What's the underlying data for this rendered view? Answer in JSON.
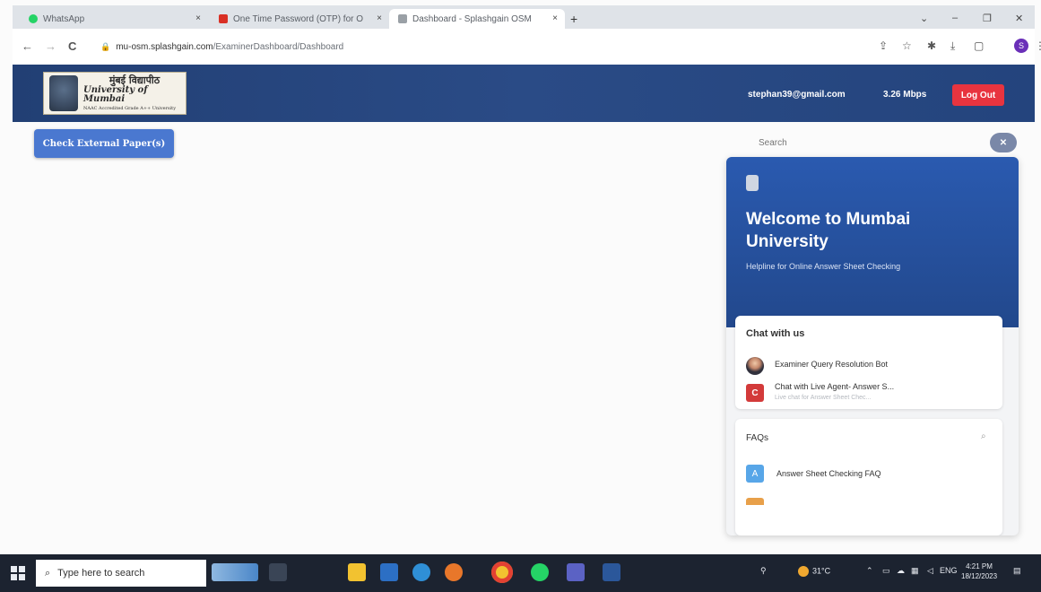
{
  "browser": {
    "tabs": [
      {
        "label": "WhatsApp",
        "favicon_color": "#25d366",
        "active": false
      },
      {
        "label": "One Time Password (OTP) for O",
        "favicon_color": "#d93025",
        "active": false
      },
      {
        "label": "Dashboard - Splashgain OSM",
        "favicon_color": "#9aa0a6",
        "active": true
      }
    ],
    "tab_close_glyph": "×",
    "new_tab_glyph": "+",
    "window_controls": [
      "⌄",
      "–",
      "❐",
      "✕"
    ],
    "nav": {
      "back": "←",
      "forward": "→",
      "reload": "C"
    },
    "url": {
      "host": "mu-osm.splashgain.com",
      "path": "/ExaminerDashboard/Dashboard"
    },
    "toolbar_icons": [
      "share-icon",
      "star-icon",
      "extensions-icon",
      "download-icon",
      "sidebar-icon"
    ],
    "profile_initial": "S",
    "menu_glyph": "⋮"
  },
  "header": {
    "logo": {
      "line1": "मुंबई विद्यापीठ",
      "line2": "University of Mumbai",
      "line3": "NAAC Accredited Grade A++ University"
    },
    "user_email": "stephan39@gmail.com",
    "speed": "3.26 Mbps",
    "logout_label": "Log Out",
    "colors": {
      "bar": "#223f74",
      "logout": "#e8343f"
    }
  },
  "main": {
    "check_button_label": "Check External Paper(s)"
  },
  "chat": {
    "search_placeholder": "Search",
    "close_glyph": "✕",
    "welcome_title": "Welcome to Mumbai University",
    "welcome_subtitle": "Helpline for Online Answer Sheet Checking",
    "chat_section_title": "Chat with us",
    "items": [
      {
        "name": "Examiner Query Resolution Bot",
        "desc": ""
      },
      {
        "name": "Chat with Live Agent- Answer S...",
        "desc": "Live chat for Answer Sheet Chec...",
        "avatar_letter": "C"
      }
    ],
    "faq_title": "FAQs",
    "faq_items": [
      {
        "letter": "A",
        "label": "Answer Sheet Checking FAQ"
      }
    ],
    "colors": {
      "header": "#2a5ab0",
      "faq_icon": "#58a6e8",
      "agent_avatar": "#d33a3a"
    }
  },
  "taskbar": {
    "search_placeholder": "Type here to search",
    "pinned_apps": [
      "file-explorer-icon",
      "calendar-icon",
      "edge-icon",
      "firefox-icon",
      "chrome-icon",
      "whatsapp-icon",
      "teams-icon",
      "word-icon"
    ],
    "weather": "31°C",
    "language": "ENG",
    "time": "4:21 PM",
    "date": "18/12/2023"
  }
}
